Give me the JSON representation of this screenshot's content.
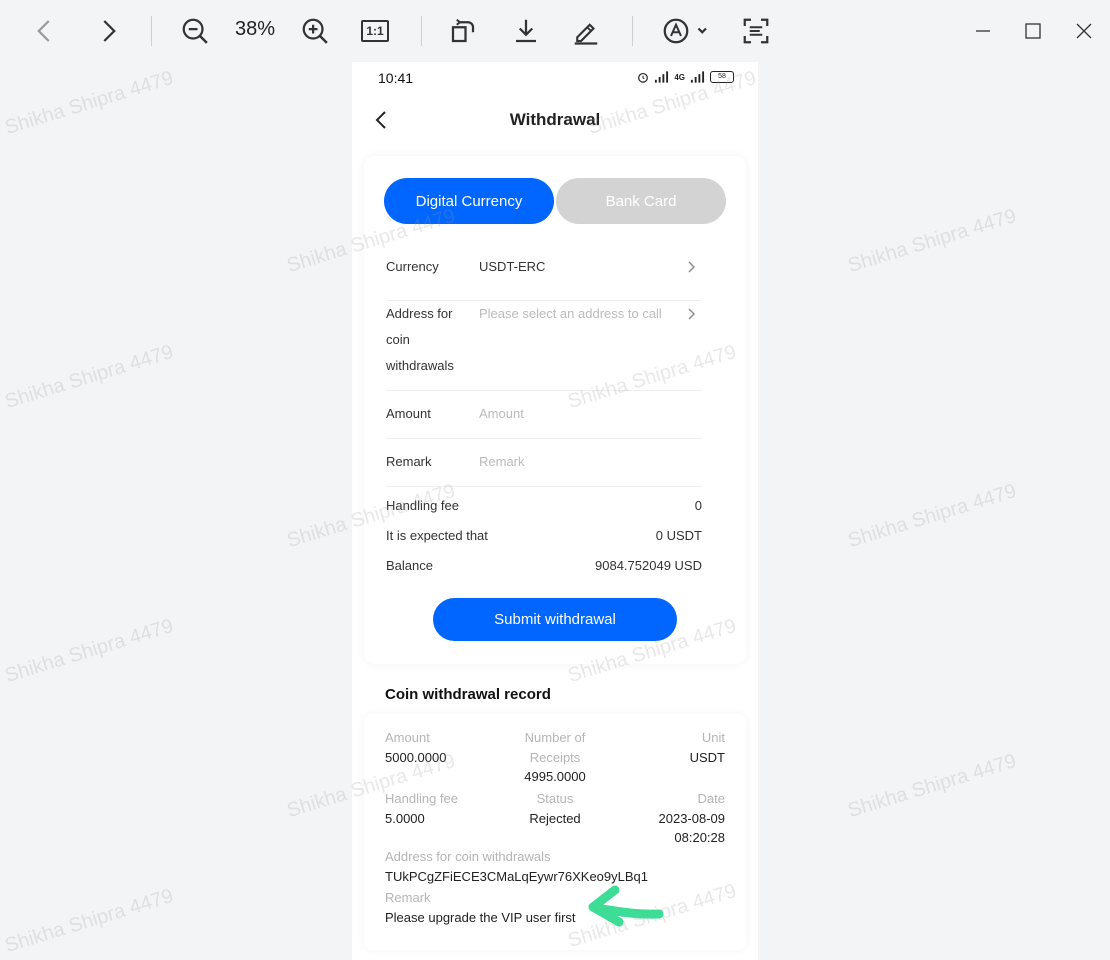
{
  "viewer": {
    "zoom": "38%",
    "actual_size_label": "1:1"
  },
  "watermark": "Shikha Shipra 4479",
  "phone": {
    "status": {
      "time": "10:41",
      "network": "4G",
      "battery": "58"
    },
    "nav": {
      "title": "Withdrawal"
    },
    "tabs": {
      "digital": "Digital Currency",
      "bank": "Bank Card"
    },
    "form": {
      "currency": {
        "label": "Currency",
        "value": "USDT-ERC"
      },
      "address": {
        "label_lines": [
          "Address for",
          "coin",
          "withdrawals"
        ],
        "placeholder": "Please select an address to call"
      },
      "amount": {
        "label": "Amount",
        "placeholder": "Amount"
      },
      "remark": {
        "label": "Remark",
        "placeholder": "Remark"
      }
    },
    "summary": {
      "fee": {
        "label": "Handling fee",
        "value": "0"
      },
      "expected": {
        "label": "It is expected that",
        "value": "0 USDT"
      },
      "balance": {
        "label": "Balance",
        "value": "9084.752049 USD"
      }
    },
    "submit_label": "Submit withdrawal",
    "record": {
      "title": "Coin withdrawal record",
      "amount": {
        "label": "Amount",
        "value": "5000.0000"
      },
      "receipts": {
        "label_lines": [
          "Number of",
          "Receipts"
        ],
        "value": "4995.0000"
      },
      "unit": {
        "label": "Unit",
        "value": "USDT"
      },
      "fee": {
        "label": "Handling fee",
        "value": "5.0000"
      },
      "status": {
        "label": "Status",
        "value": "Rejected"
      },
      "date": {
        "label": "Date",
        "value_lines": [
          "2023-08-09",
          "08:20:28"
        ]
      },
      "address": {
        "label": "Address for coin withdrawals",
        "value": "TUkPCgZFiECE3CMaLqEywr76XKeo9yLBq1"
      },
      "remark": {
        "label": "Remark",
        "value": "Please upgrade the VIP user first"
      }
    },
    "annotation_color": "#3ddc97"
  }
}
